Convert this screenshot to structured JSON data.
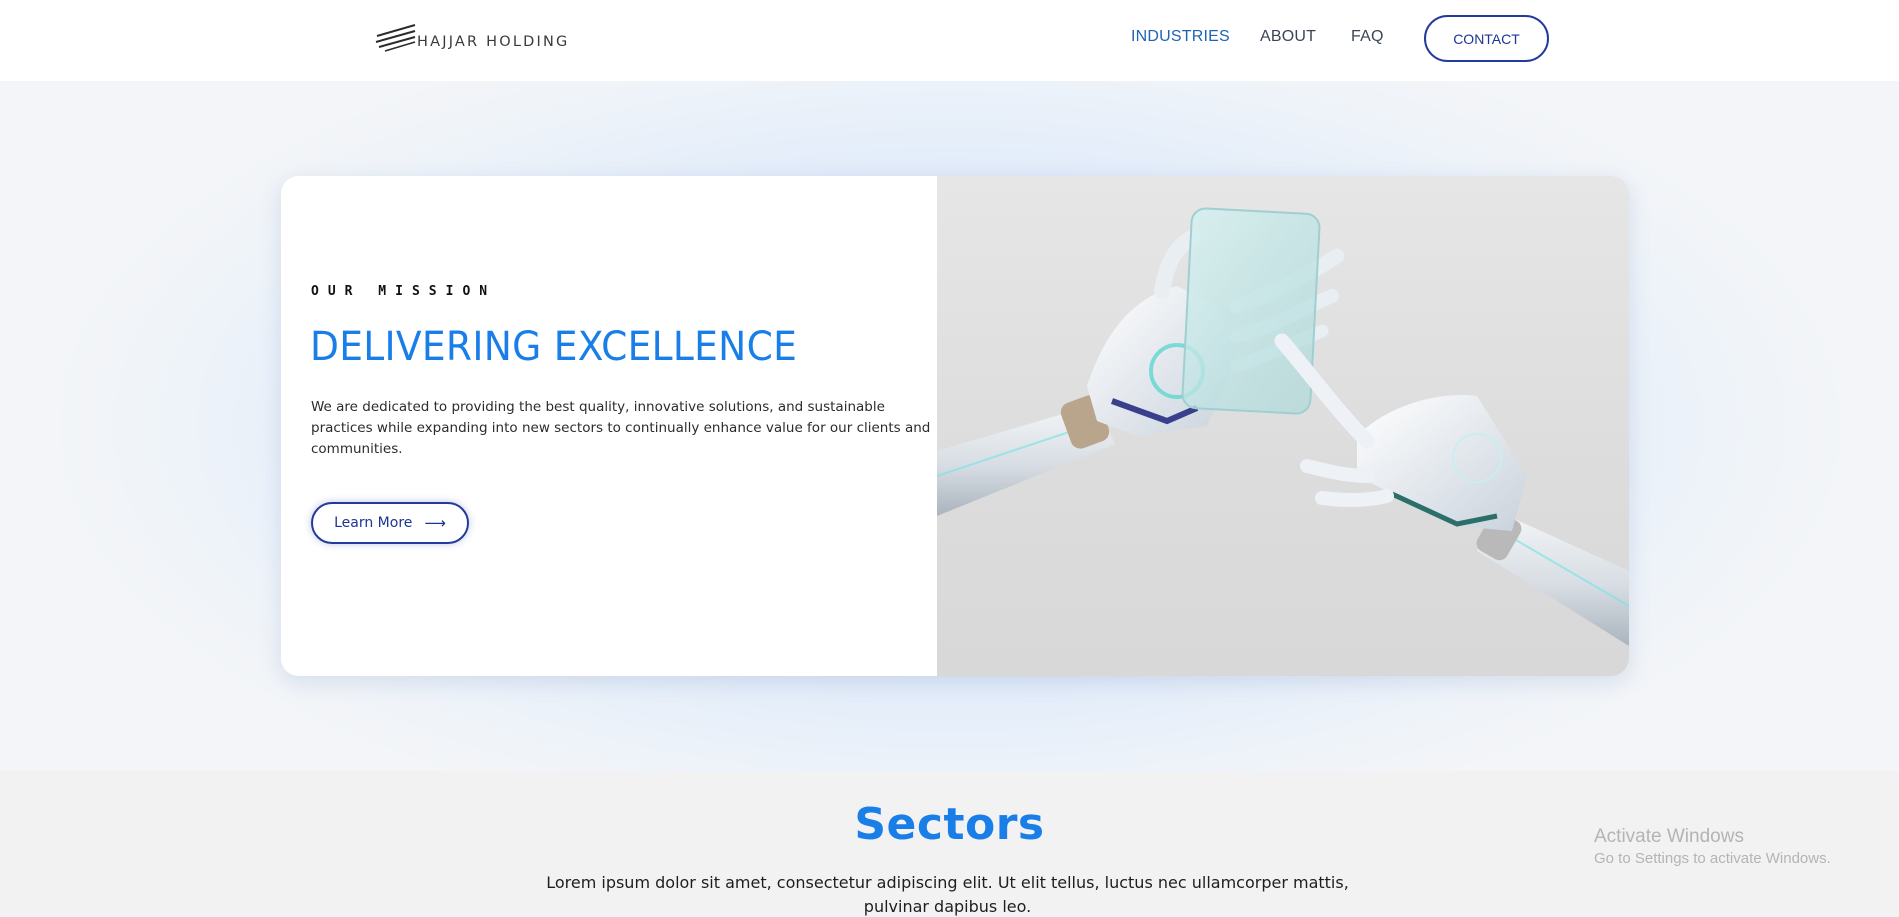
{
  "header": {
    "logo_text": "HAJJAR HOLDING",
    "nav": {
      "industries": "INDUSTRIES",
      "about": "ABOUT",
      "faq": "FAQ"
    },
    "contact_label": "CONTACT"
  },
  "hero": {
    "eyebrow": "OUR MISSION",
    "title": "DELIVERING EXCELLENCE",
    "description": "We are dedicated to providing the best quality, innovative solutions, and sustainable practices while expanding into new sectors to continually enhance value for our clients and communities.",
    "button_label": "Learn More",
    "button_arrow": "⟶"
  },
  "sectors": {
    "title": "Sectors",
    "description": "Lorem ipsum dolor sit amet, consectetur adipiscing elit. Ut elit tellus, luctus nec ullamcorper mattis, pulvinar dapibus leo."
  },
  "watermark": {
    "title": "Activate Windows",
    "subtitle": "Go to Settings to activate Windows."
  },
  "colors": {
    "accent_blue": "#1a7ee8",
    "nav_active": "#1f63b5",
    "button_border": "#223a9c"
  }
}
